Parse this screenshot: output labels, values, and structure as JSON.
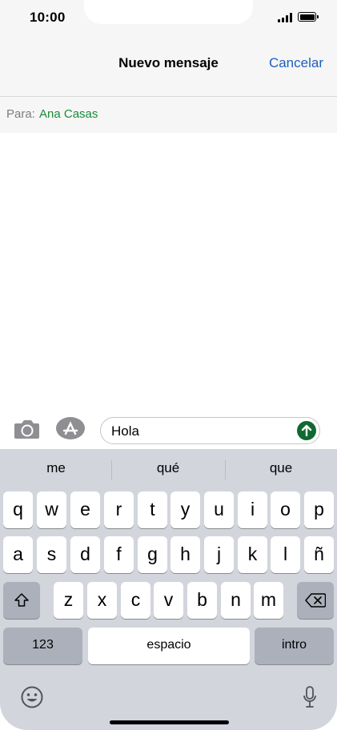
{
  "status": {
    "time": "10:00"
  },
  "nav": {
    "title": "Nuevo mensaje",
    "cancel": "Cancelar"
  },
  "to": {
    "label": "Para:",
    "recipient": "Ana Casas"
  },
  "compose": {
    "text": "Hola"
  },
  "suggestions": [
    "me",
    "qué",
    "que"
  ],
  "keys": {
    "row1": [
      "q",
      "w",
      "e",
      "r",
      "t",
      "y",
      "u",
      "i",
      "o",
      "p"
    ],
    "row2": [
      "a",
      "s",
      "d",
      "f",
      "g",
      "h",
      "j",
      "k",
      "l",
      "ñ"
    ],
    "row3": [
      "z",
      "x",
      "c",
      "v",
      "b",
      "n",
      "m"
    ],
    "numbers": "123",
    "space": "espacio",
    "return": "intro"
  },
  "icons": {
    "camera": "camera-icon",
    "appstore": "app-store-icon",
    "send": "send-arrow-icon",
    "shift": "shift-icon",
    "delete": "delete-icon",
    "emoji": "emoji-icon",
    "mic": "microphone-icon"
  },
  "colors": {
    "link": "#1d5fbd",
    "recipient": "#1a8a3a",
    "send": "#11692f",
    "keyboard_bg": "#d2d5dc"
  }
}
